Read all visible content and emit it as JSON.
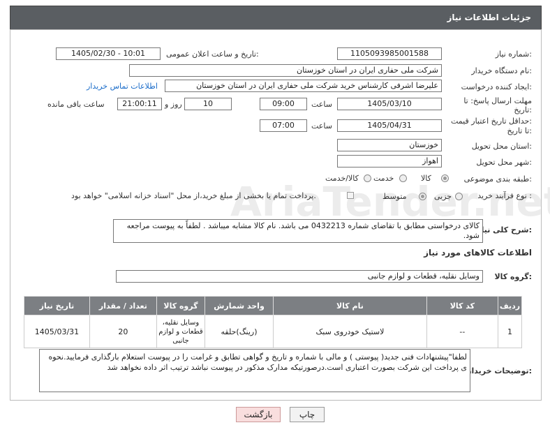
{
  "header": {
    "title": "جزئیات اطلاعات نیاز"
  },
  "fields": {
    "need_number_label": "شماره نیاز:",
    "need_number": "1105093985001588",
    "announce_label": "تاریخ و ساعت اعلان عمومی:",
    "announce_value": "1405/02/30 - 10:01",
    "buyer_org_label": "نام دستگاه خریدار:",
    "buyer_org": "شرکت ملی حفاری ایران در استان خوزستان",
    "creator_label": "ایجاد کننده درخواست:",
    "creator": "علیرضا اشرفی کارشناس خرید شرکت ملی حفاری ایران در استان خوزستان",
    "contact_link": "اطلاعات تماس خریدار",
    "deadline_label_1": "مهلت ارسال پاسخ: تا",
    "deadline_label_2": "تاریخ:",
    "deadline_date": "1405/03/10",
    "time_label": "ساعت",
    "deadline_time": "09:00",
    "days_value": "10",
    "days_label": "روز و",
    "remaining_time": "21:00:11",
    "remaining_label": "ساعت باقی مانده",
    "validity_label_1": "حداقل تاریخ اعتبار قیمت:",
    "validity_label_2": "تا تاریخ:",
    "validity_date": "1405/04/31",
    "validity_time": "07:00",
    "province_label": "استان محل تحویل:",
    "province": "خوزستان",
    "city_label": "شهر محل تحویل:",
    "city": "اهواز",
    "category_label": "طبقه بندی موضوعی:",
    "category_options": [
      "کالا",
      "خدمت",
      "کالا/خدمت"
    ],
    "process_label": "نوع فرآیند خرید :",
    "process_options": [
      "جزیی",
      "متوسط"
    ],
    "payment_note": "پرداخت تمام یا بخشی از مبلغ خرید،از محل \"اسناد خزانه اسلامی\" خواهد بود.",
    "summary_label": "شرح کلی نیاز:",
    "summary": "کالای درخواستی مطابق با تقاضای شماره 0432213 می باشد. نام کالا مشابه میباشد . لطفاً به پیوست مراجعه شود.",
    "goods_info_title": "اطلاعات کالاهای مورد نیاز",
    "goods_group_label": "گروه کالا:",
    "goods_group": "وسایل نقلیه، قطعات و لوازم جانبی"
  },
  "table": {
    "headers": [
      "ردیف",
      "کد کالا",
      "نام کالا",
      "واحد شمارش",
      "گروه کالا",
      "تعداد / مقدار",
      "تاریخ نیاز"
    ],
    "rows": [
      [
        "1",
        "--",
        "لاستیک خودروی سبک",
        "(رینگ)حلقه",
        "وسایل نقلیه، قطعات و لوازم جانبی",
        "20",
        "1405/03/31"
      ]
    ]
  },
  "buyer_notes_label": "توضیحات خریدار:",
  "buyer_notes": "لطفا\"پیشنهادات فنی جدید( پیوستی ) و مالی با شماره و تاریخ و گواهی تطابق و غرامت را در پیوست استعلام بارگذاری فرمایید.نحوه ی پرداخت این شرکت بصورت اعتباری است.درصورتیکه مدارک مذکور در پیوست نباشد ترتیب اثر داده نخواهد شد",
  "buttons": {
    "print": "چاپ",
    "back": "بازگشت"
  },
  "watermark": "AriaTender.net"
}
